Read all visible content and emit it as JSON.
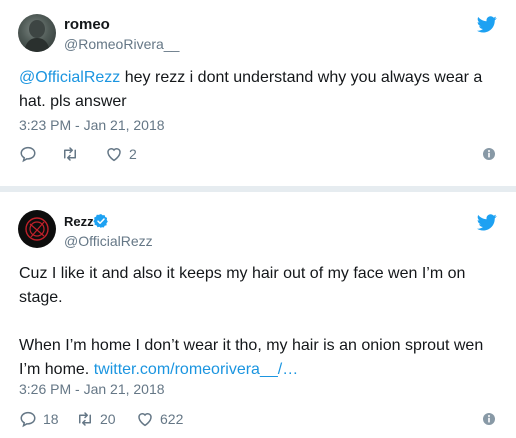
{
  "tweets": [
    {
      "name": "romeo",
      "handle": "@RomeoRivera__",
      "text_mention": "@OfficialRezz",
      "text_body": " hey rezz i dont understand why you always wear a hat. pls answer",
      "timestamp": "3:23 PM - Jan 21, 2018",
      "replies": "",
      "retweets": "",
      "likes": "2"
    },
    {
      "name": "Rezz",
      "handle": "@OfficialRezz",
      "verified": true,
      "text_p1": "Cuz I like it and also it keeps my hair out of my face wen I’m on stage.",
      "text_p2": "When I’m home I don’t wear it tho, my hair is an onion sprout wen I’m home. ",
      "text_link": "twitter.com/romeorivera__/…",
      "timestamp": "3:26 PM - Jan 21, 2018",
      "replies": "18",
      "retweets": "20",
      "likes": "622"
    }
  ],
  "colors": {
    "twitter_blue": "#1da1f2",
    "link": "#1b95e0",
    "secondary": "#657786",
    "divider": "#e6ecf0"
  },
  "icons": [
    "twitter-bird-icon",
    "verified-badge-icon",
    "reply-icon",
    "retweet-icon",
    "like-icon",
    "info-icon"
  ]
}
